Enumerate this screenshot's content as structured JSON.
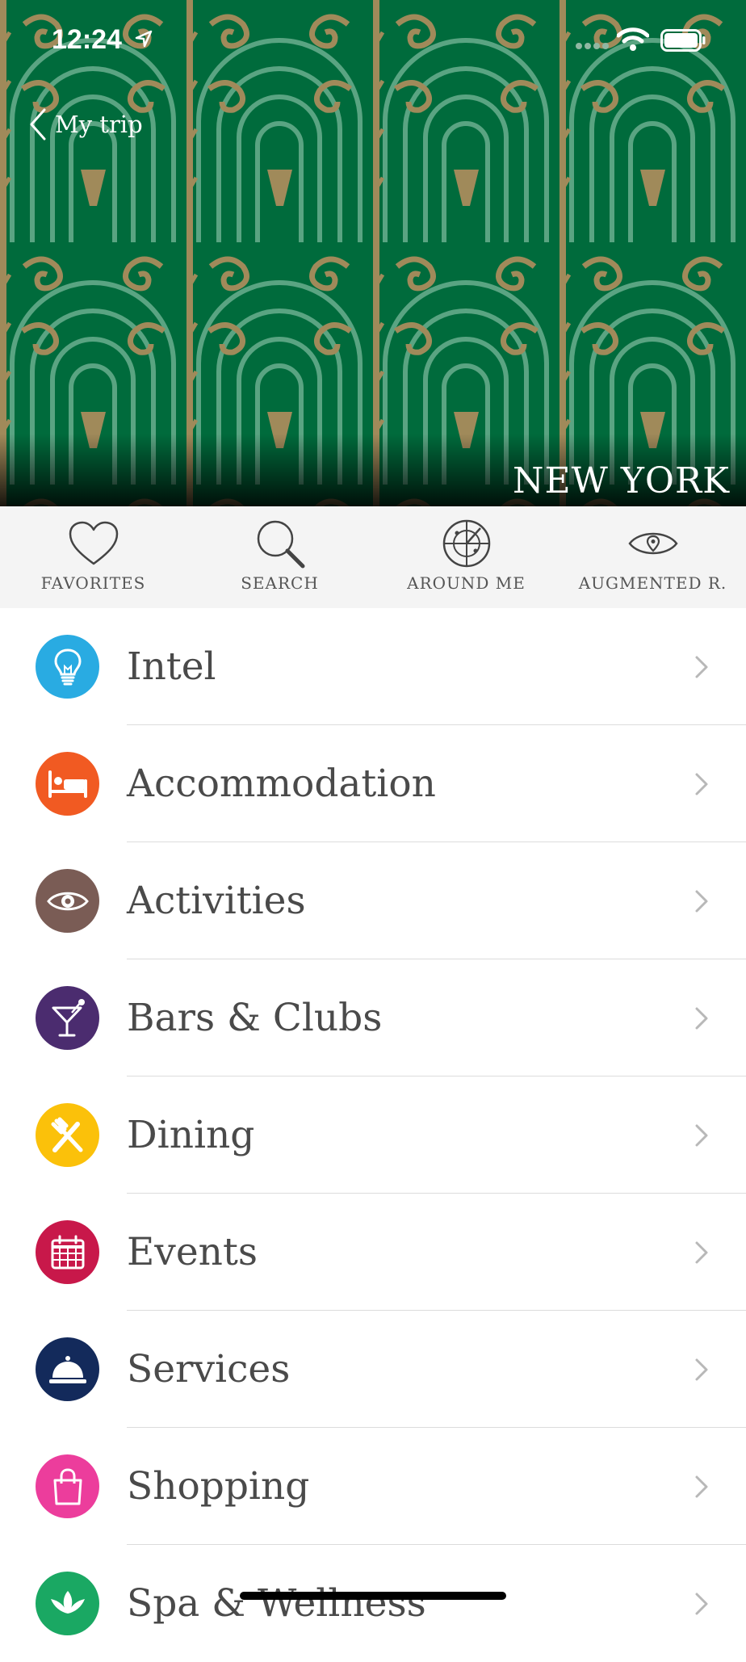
{
  "status_bar": {
    "time": "12:24"
  },
  "header": {
    "back_label": "My trip",
    "city_title": "NEW YORK"
  },
  "toolbar": {
    "items": [
      {
        "label": "FAVORITES",
        "icon": "heart-icon"
      },
      {
        "label": "SEARCH",
        "icon": "search-icon"
      },
      {
        "label": "AROUND ME",
        "icon": "radar-icon"
      },
      {
        "label": "AUGMENTED R.",
        "icon": "eye-pin-icon"
      }
    ]
  },
  "categories": [
    {
      "label": "Intel",
      "icon": "lightbulb-icon",
      "color": "#29abe2"
    },
    {
      "label": "Accommodation",
      "icon": "bed-icon",
      "color": "#f15a22"
    },
    {
      "label": "Activities",
      "icon": "eye-icon",
      "color": "#7a5c55"
    },
    {
      "label": "Bars & Clubs",
      "icon": "cocktail-icon",
      "color": "#4b2c6f"
    },
    {
      "label": "Dining",
      "icon": "fork-knife-icon",
      "color": "#fbc10a"
    },
    {
      "label": "Events",
      "icon": "calendar-icon",
      "color": "#c8184a"
    },
    {
      "label": "Services",
      "icon": "service-bell-icon",
      "color": "#132a5b"
    },
    {
      "label": "Shopping",
      "icon": "shopping-bag-icon",
      "color": "#ec3d9c"
    },
    {
      "label": "Spa & Wellness",
      "icon": "lotus-icon",
      "color": "#1aa863"
    }
  ],
  "colors": {
    "hero_background": "#006b3c",
    "pattern_light": "#5aa482",
    "pattern_gold": "#a08a5a",
    "toolbar_background": "#f4f4f4",
    "label_text": "#4a4a4a",
    "chevron": "#b8b8b8"
  }
}
